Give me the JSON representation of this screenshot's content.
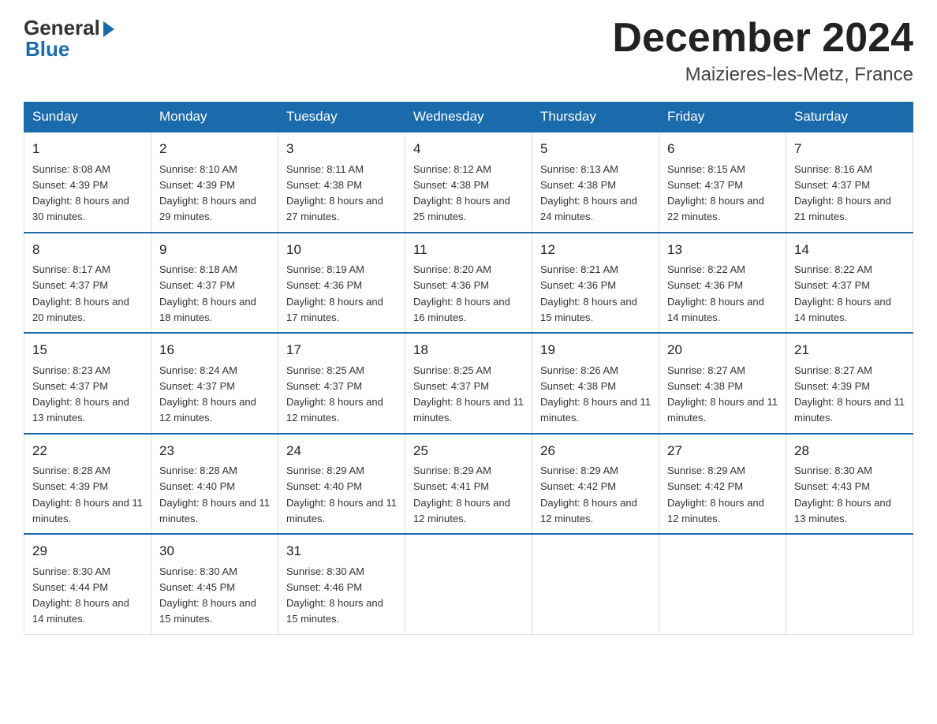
{
  "header": {
    "logo_general": "General",
    "logo_blue": "Blue",
    "month_title": "December 2024",
    "location": "Maizieres-les-Metz, France"
  },
  "days_of_week": [
    "Sunday",
    "Monday",
    "Tuesday",
    "Wednesday",
    "Thursday",
    "Friday",
    "Saturday"
  ],
  "weeks": [
    [
      {
        "day": "1",
        "sunrise": "8:08 AM",
        "sunset": "4:39 PM",
        "daylight": "8 hours and 30 minutes."
      },
      {
        "day": "2",
        "sunrise": "8:10 AM",
        "sunset": "4:39 PM",
        "daylight": "8 hours and 29 minutes."
      },
      {
        "day": "3",
        "sunrise": "8:11 AM",
        "sunset": "4:38 PM",
        "daylight": "8 hours and 27 minutes."
      },
      {
        "day": "4",
        "sunrise": "8:12 AM",
        "sunset": "4:38 PM",
        "daylight": "8 hours and 25 minutes."
      },
      {
        "day": "5",
        "sunrise": "8:13 AM",
        "sunset": "4:38 PM",
        "daylight": "8 hours and 24 minutes."
      },
      {
        "day": "6",
        "sunrise": "8:15 AM",
        "sunset": "4:37 PM",
        "daylight": "8 hours and 22 minutes."
      },
      {
        "day": "7",
        "sunrise": "8:16 AM",
        "sunset": "4:37 PM",
        "daylight": "8 hours and 21 minutes."
      }
    ],
    [
      {
        "day": "8",
        "sunrise": "8:17 AM",
        "sunset": "4:37 PM",
        "daylight": "8 hours and 20 minutes."
      },
      {
        "day": "9",
        "sunrise": "8:18 AM",
        "sunset": "4:37 PM",
        "daylight": "8 hours and 18 minutes."
      },
      {
        "day": "10",
        "sunrise": "8:19 AM",
        "sunset": "4:36 PM",
        "daylight": "8 hours and 17 minutes."
      },
      {
        "day": "11",
        "sunrise": "8:20 AM",
        "sunset": "4:36 PM",
        "daylight": "8 hours and 16 minutes."
      },
      {
        "day": "12",
        "sunrise": "8:21 AM",
        "sunset": "4:36 PM",
        "daylight": "8 hours and 15 minutes."
      },
      {
        "day": "13",
        "sunrise": "8:22 AM",
        "sunset": "4:36 PM",
        "daylight": "8 hours and 14 minutes."
      },
      {
        "day": "14",
        "sunrise": "8:22 AM",
        "sunset": "4:37 PM",
        "daylight": "8 hours and 14 minutes."
      }
    ],
    [
      {
        "day": "15",
        "sunrise": "8:23 AM",
        "sunset": "4:37 PM",
        "daylight": "8 hours and 13 minutes."
      },
      {
        "day": "16",
        "sunrise": "8:24 AM",
        "sunset": "4:37 PM",
        "daylight": "8 hours and 12 minutes."
      },
      {
        "day": "17",
        "sunrise": "8:25 AM",
        "sunset": "4:37 PM",
        "daylight": "8 hours and 12 minutes."
      },
      {
        "day": "18",
        "sunrise": "8:25 AM",
        "sunset": "4:37 PM",
        "daylight": "8 hours and 11 minutes."
      },
      {
        "day": "19",
        "sunrise": "8:26 AM",
        "sunset": "4:38 PM",
        "daylight": "8 hours and 11 minutes."
      },
      {
        "day": "20",
        "sunrise": "8:27 AM",
        "sunset": "4:38 PM",
        "daylight": "8 hours and 11 minutes."
      },
      {
        "day": "21",
        "sunrise": "8:27 AM",
        "sunset": "4:39 PM",
        "daylight": "8 hours and 11 minutes."
      }
    ],
    [
      {
        "day": "22",
        "sunrise": "8:28 AM",
        "sunset": "4:39 PM",
        "daylight": "8 hours and 11 minutes."
      },
      {
        "day": "23",
        "sunrise": "8:28 AM",
        "sunset": "4:40 PM",
        "daylight": "8 hours and 11 minutes."
      },
      {
        "day": "24",
        "sunrise": "8:29 AM",
        "sunset": "4:40 PM",
        "daylight": "8 hours and 11 minutes."
      },
      {
        "day": "25",
        "sunrise": "8:29 AM",
        "sunset": "4:41 PM",
        "daylight": "8 hours and 12 minutes."
      },
      {
        "day": "26",
        "sunrise": "8:29 AM",
        "sunset": "4:42 PM",
        "daylight": "8 hours and 12 minutes."
      },
      {
        "day": "27",
        "sunrise": "8:29 AM",
        "sunset": "4:42 PM",
        "daylight": "8 hours and 12 minutes."
      },
      {
        "day": "28",
        "sunrise": "8:30 AM",
        "sunset": "4:43 PM",
        "daylight": "8 hours and 13 minutes."
      }
    ],
    [
      {
        "day": "29",
        "sunrise": "8:30 AM",
        "sunset": "4:44 PM",
        "daylight": "8 hours and 14 minutes."
      },
      {
        "day": "30",
        "sunrise": "8:30 AM",
        "sunset": "4:45 PM",
        "daylight": "8 hours and 15 minutes."
      },
      {
        "day": "31",
        "sunrise": "8:30 AM",
        "sunset": "4:46 PM",
        "daylight": "8 hours and 15 minutes."
      },
      null,
      null,
      null,
      null
    ]
  ],
  "labels": {
    "sunrise": "Sunrise:",
    "sunset": "Sunset:",
    "daylight": "Daylight:"
  }
}
